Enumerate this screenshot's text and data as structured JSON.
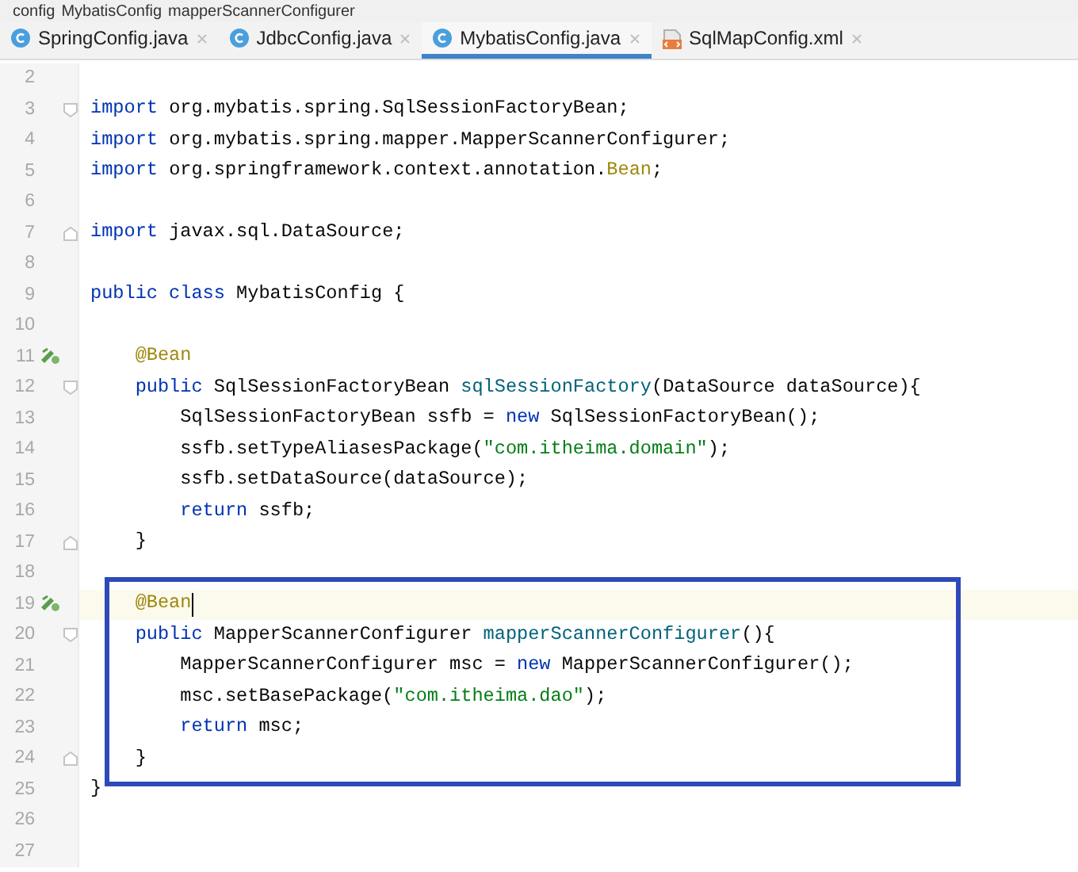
{
  "breadcrumb": [
    "config",
    "MybatisConfig",
    "mapperScannerConfigurer"
  ],
  "tabs": [
    {
      "label": "SpringConfig.java",
      "kind": "java",
      "selected": false
    },
    {
      "label": "JdbcConfig.java",
      "kind": "java",
      "selected": false
    },
    {
      "label": "MybatisConfig.java",
      "kind": "java",
      "selected": true
    },
    {
      "label": "SqlMapConfig.xml",
      "kind": "xml",
      "selected": false
    }
  ],
  "blocks": [
    {
      "boxed": false,
      "lines": [
        {
          "number": "2"
        },
        {
          "number": "3",
          "fold_start": true,
          "tokens": [
            {
              "kind": "keyword",
              "text": "import"
            },
            {
              "kind": "plain",
              "text": " org.mybatis.spring.SqlSessionFactoryBean;"
            }
          ]
        },
        {
          "number": "4",
          "tokens": [
            {
              "kind": "keyword",
              "text": "import"
            },
            {
              "kind": "plain",
              "text": " org.mybatis.spring.mapper.MapperScannerConfigurer;"
            }
          ]
        },
        {
          "number": "5",
          "tokens": [
            {
              "kind": "keyword",
              "text": "import"
            },
            {
              "kind": "plain",
              "text": " org.springframework.context.annotation."
            },
            {
              "kind": "annotation",
              "text": "Bean"
            },
            {
              "kind": "plain",
              "text": ";"
            }
          ]
        },
        {
          "number": "6"
        },
        {
          "number": "7",
          "fold_end": true,
          "tokens": [
            {
              "kind": "keyword",
              "text": "import"
            },
            {
              "kind": "plain",
              "text": " javax.sql.DataSource;"
            }
          ]
        },
        {
          "number": "8"
        },
        {
          "number": "9",
          "tokens": [
            {
              "kind": "keyword",
              "text": "public class"
            },
            {
              "kind": "plain",
              "text": " MybatisConfig {"
            }
          ]
        },
        {
          "number": "10"
        },
        {
          "number": "11",
          "bean": true,
          "tokens": [
            {
              "kind": "annotation",
              "text": "    @Bean"
            }
          ]
        },
        {
          "number": "12",
          "fold_start": true,
          "tokens": [
            {
              "kind": "keyword",
              "text": "    public"
            },
            {
              "kind": "plain",
              "text": " SqlSessionFactoryBean "
            },
            {
              "kind": "method",
              "text": "sqlSessionFactory"
            },
            {
              "kind": "plain",
              "text": "(DataSource dataSource){"
            }
          ]
        },
        {
          "number": "13",
          "tokens": [
            {
              "kind": "plain",
              "text": "        SqlSessionFactoryBean ssfb = "
            },
            {
              "kind": "keyword",
              "text": "new"
            },
            {
              "kind": "plain",
              "text": " SqlSessionFactoryBean();"
            }
          ]
        },
        {
          "number": "14",
          "tokens": [
            {
              "kind": "plain",
              "text": "        ssfb.setTypeAliasesPackage("
            },
            {
              "kind": "string",
              "text": "\"com.itheima.domain\""
            },
            {
              "kind": "plain",
              "text": ");"
            }
          ]
        },
        {
          "number": "15",
          "tokens": [
            {
              "kind": "plain",
              "text": "        ssfb.setDataSource(dataSource);"
            }
          ]
        },
        {
          "number": "16",
          "tokens": [
            {
              "kind": "keyword",
              "text": "        return"
            },
            {
              "kind": "plain",
              "text": " ssfb;"
            }
          ]
        },
        {
          "number": "17",
          "fold_end": true,
          "tokens": [
            {
              "kind": "plain",
              "text": "    }"
            }
          ]
        },
        {
          "number": "18"
        }
      ]
    },
    {
      "boxed": true,
      "lines": [
        {
          "number": "19",
          "bean": true,
          "current": true,
          "tokens": [
            {
              "kind": "annotation",
              "text": "    @Bean"
            }
          ]
        },
        {
          "number": "20",
          "fold_start": true,
          "tokens": [
            {
              "kind": "keyword",
              "text": "    public"
            },
            {
              "kind": "plain",
              "text": " MapperScannerConfigurer "
            },
            {
              "kind": "method",
              "text": "mapperScannerConfigurer"
            },
            {
              "kind": "plain",
              "text": "(){"
            }
          ]
        },
        {
          "number": "21",
          "tokens": [
            {
              "kind": "plain",
              "text": "        MapperScannerConfigurer msc = "
            },
            {
              "kind": "keyword",
              "text": "new"
            },
            {
              "kind": "plain",
              "text": " MapperScannerConfigurer();"
            }
          ]
        },
        {
          "number": "22",
          "tokens": [
            {
              "kind": "plain",
              "text": "        msc.setBasePackage("
            },
            {
              "kind": "string",
              "text": "\"com.itheima.dao\""
            },
            {
              "kind": "plain",
              "text": ");"
            }
          ]
        },
        {
          "number": "23",
          "tokens": [
            {
              "kind": "keyword",
              "text": "        return"
            },
            {
              "kind": "plain",
              "text": " msc;"
            }
          ]
        },
        {
          "number": "24",
          "fold_end": true,
          "tokens": [
            {
              "kind": "plain",
              "text": "    }"
            }
          ]
        }
      ]
    },
    {
      "boxed": false,
      "lines": [
        {
          "number": "25",
          "tokens": [
            {
              "kind": "plain",
              "text": "}"
            }
          ]
        },
        {
          "number": "26"
        },
        {
          "number": "27"
        }
      ]
    }
  ]
}
